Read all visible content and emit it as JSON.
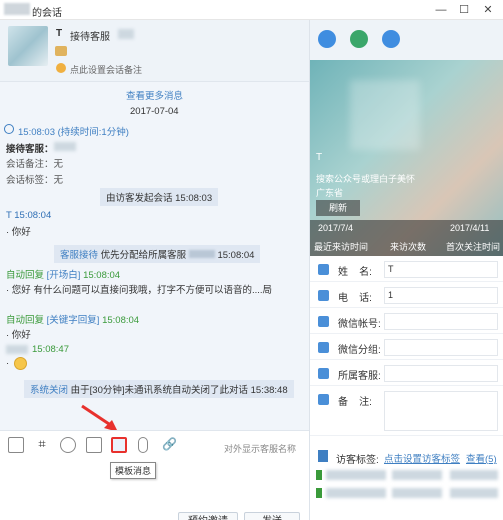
{
  "window": {
    "title": "的会话"
  },
  "header": {
    "name_prefix": "T",
    "name": "接待客服",
    "note_placeholder": "点此设置会话备注"
  },
  "chat": {
    "more": "查看更多消息",
    "date": "2017-07-04",
    "session_time": "15:08:03 (持续时间:1分钟)",
    "agent_label": "接待客服：",
    "note_label": "会话备注：无",
    "tag_label": "会话标签：无",
    "visitor_start": "由访客发起会话 15:08:03",
    "m1_sender": "T 15:08:04",
    "m1_text": "· 你好",
    "sys1_tag": "客服接待",
    "sys1_text": "优先分配给所属客服",
    "sys1_time": "15:08:04",
    "auto1_prefix": "自动回复",
    "auto1_tag": "[开场白]",
    "auto1_time": "15:08:04",
    "auto1_text": "· 您好 有什么问题可以直接问我哦，打字不方便可以语音的....局",
    "auto2_prefix": "自动回复",
    "auto2_tag": "[关键字回复]",
    "auto2_time": "15:08:04",
    "auto2_text": "· 你好",
    "m3_time": "15:08:47",
    "m3_bullet": "·",
    "close_tag": "系统关闭",
    "close_text": "由于[30分钟]未通讯系统自动关闭了此对话 15:38:48"
  },
  "toolbar": {
    "show_agent": "对外显示客服名称",
    "tooltip": "模板消息"
  },
  "input": {
    "invite": "预约邀请",
    "send": "发送"
  },
  "profile": {
    "caption": "搜索公众号或理白子美怀",
    "location": "广东省",
    "refresh": "刷新",
    "name_initial": "T",
    "stats": [
      {
        "date": "2017/7/4",
        "label": "最近来访时间"
      },
      {
        "date": "",
        "label": "来访次数"
      },
      {
        "date": "2017/4/11",
        "label": "首次关注时间"
      }
    ],
    "fields": [
      {
        "label": "姓    名:",
        "value": "T"
      },
      {
        "label": "电    话:",
        "value": "1"
      },
      {
        "label": "微信帐号:",
        "value": ""
      },
      {
        "label": "微信分组:",
        "value": ""
      },
      {
        "label": "所属客服:",
        "value": ""
      },
      {
        "label": "备    注:",
        "value": ""
      }
    ],
    "tags_label": "访客标签:",
    "tags_link": "点击设置访客标签",
    "tags_all": "查看(5)"
  },
  "colors": {
    "accent": "#3f7fc2",
    "green": "#3a9a3a",
    "highlight": "#e8312d"
  }
}
